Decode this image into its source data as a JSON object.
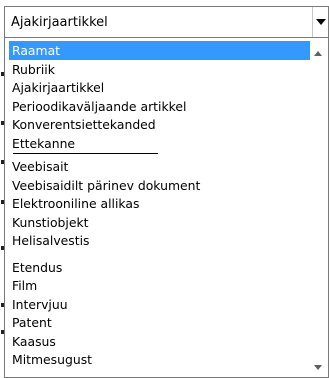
{
  "select": {
    "value": "Ajakirjaartikkel",
    "arrow_icon": "chevron-down-icon"
  },
  "dropdown": {
    "options": [
      {
        "label": "Raamat",
        "selected": true
      },
      {
        "label": "Rubriik",
        "selected": false
      },
      {
        "label": "Ajakirjaartikkel",
        "selected": false
      },
      {
        "label": "Perioodikaväljaande artikkel",
        "selected": false
      },
      {
        "label": "Konverentsiettekanded",
        "selected": false
      },
      {
        "label": "Ettekanne",
        "selected": false
      },
      {
        "label": "Veebisait",
        "selected": false
      },
      {
        "label": "Veebisaidilt pärinev dokument",
        "selected": false
      },
      {
        "label": "Elektrooniline allikas",
        "selected": false
      },
      {
        "label": "Kunstiobjekt",
        "selected": false
      },
      {
        "label": "Helisalvestis",
        "selected": false
      },
      {
        "label": "Etendus",
        "selected": false
      },
      {
        "label": "Film",
        "selected": false
      },
      {
        "label": "Intervjuu",
        "selected": false
      },
      {
        "label": "Patent",
        "selected": false
      },
      {
        "label": "Kaasus",
        "selected": false
      },
      {
        "label": "Mitmesugust",
        "selected": false
      }
    ],
    "selected_color": "#3399ff",
    "scroll_up_icon": "scroll-up-arrow-icon",
    "scroll_down_icon": "scroll-down-arrow-icon"
  }
}
